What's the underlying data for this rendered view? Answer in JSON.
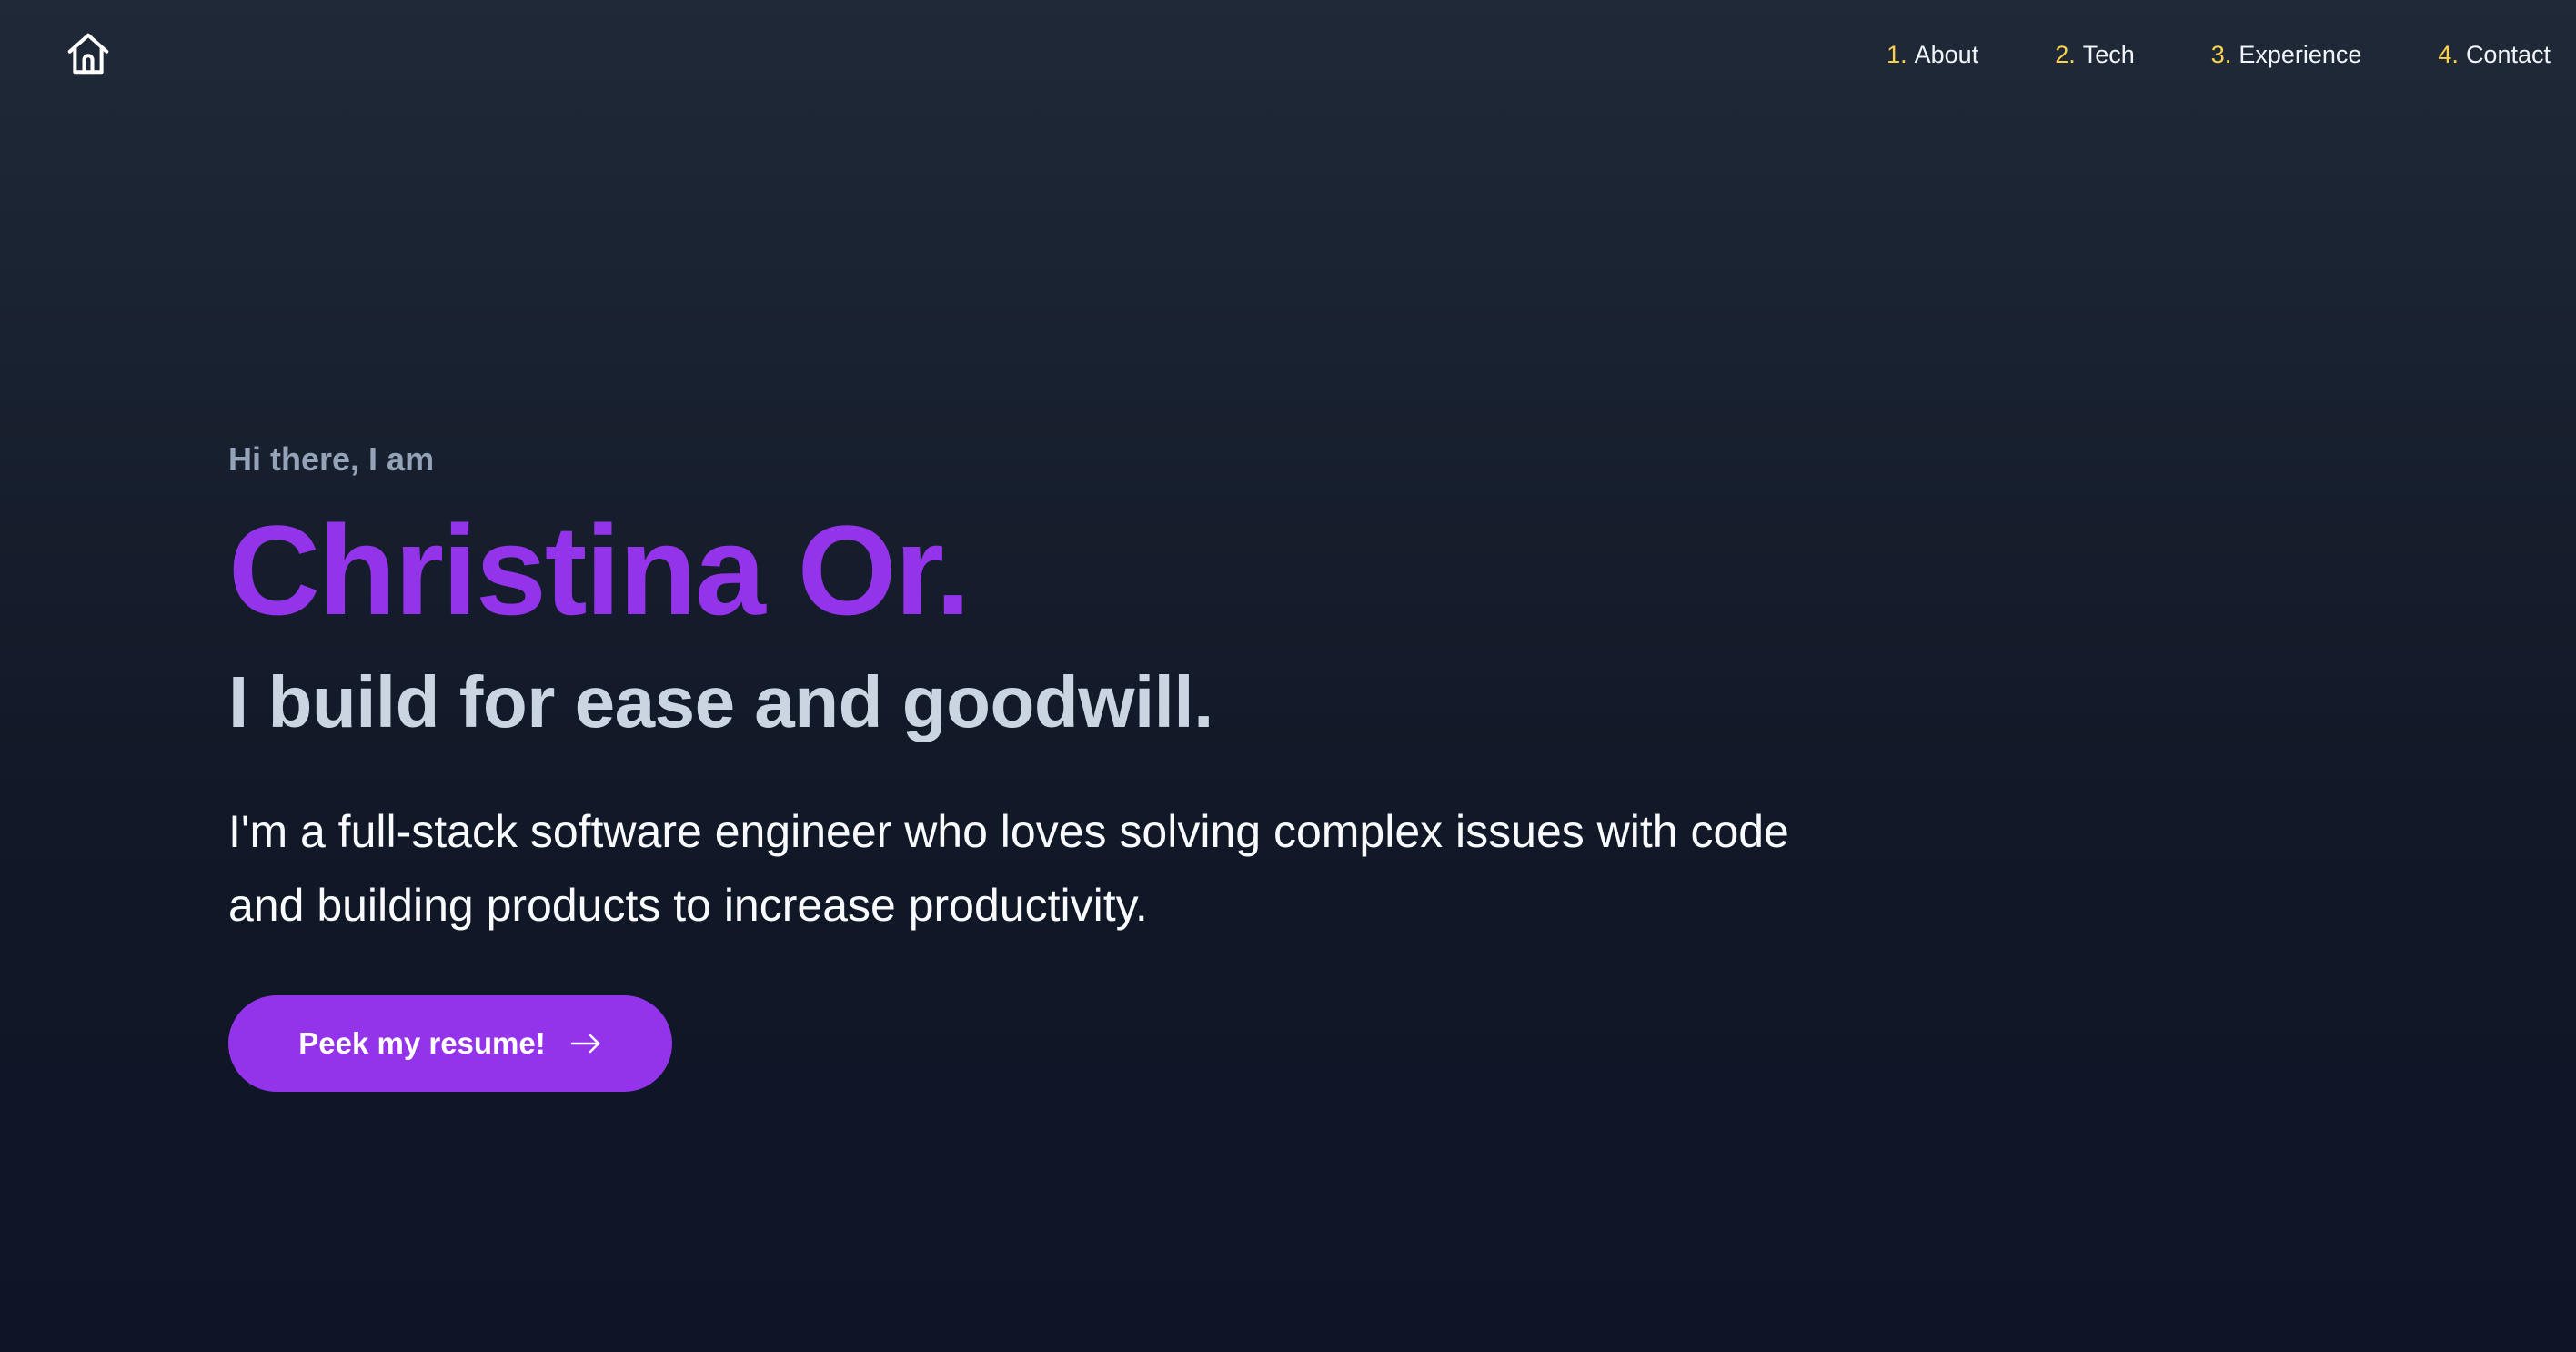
{
  "header": {
    "home_icon": "home-icon",
    "nav": [
      {
        "number": "1.",
        "label": "About"
      },
      {
        "number": "2.",
        "label": "Tech"
      },
      {
        "number": "3.",
        "label": "Experience"
      },
      {
        "number": "4.",
        "label": "Contact"
      }
    ]
  },
  "hero": {
    "greeting": "Hi there, I am",
    "name": "Christina Or.",
    "tagline": "I build for ease and goodwill.",
    "bio": "I'm a full-stack software engineer who loves solving complex issues with code and building products to increase productivity.",
    "cta_label": "Peek my resume!",
    "cta_icon": "arrow-right-icon"
  },
  "colors": {
    "background_top": "#1f2937",
    "background_bottom": "#0d1527",
    "accent": "#9333ea",
    "nav_number": "#fcd34d",
    "greeting": "#94a3b8",
    "tagline": "#cbd5e1"
  }
}
